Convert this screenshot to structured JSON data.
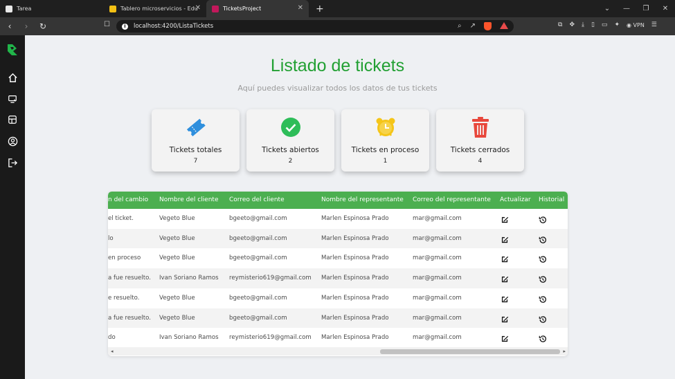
{
  "browser": {
    "tabs": [
      {
        "label": "Tarea",
        "favicon_color": "#e9e9e9"
      },
      {
        "label": "Tablero microservicios - Eduardo So",
        "favicon_color": "#f2c014"
      },
      {
        "label": "TicketsProject",
        "favicon_color": "#c2185b"
      }
    ],
    "url": "localhost:4200/ListaTickets",
    "vpn_label": "VPN"
  },
  "sidebar": {
    "items": [
      {
        "icon": "home-icon"
      },
      {
        "icon": "tickets-icon"
      },
      {
        "icon": "grid-icon"
      },
      {
        "icon": "user-circle-icon"
      },
      {
        "icon": "logout-icon"
      }
    ],
    "accent": "#21b54a"
  },
  "page": {
    "title": "Listado de tickets",
    "subtitle": "Aquí puedes visualizar todos los datos de tus tickets",
    "title_color": "#22a033"
  },
  "cards": [
    {
      "label": "Tickets totales",
      "value": "7",
      "icon": "ticket-icon",
      "color": "#2f8fdd"
    },
    {
      "label": "Tickets abiertos",
      "value": "2",
      "icon": "check-circle-icon",
      "color": "#2ebd59"
    },
    {
      "label": "Tickets en proceso",
      "value": "1",
      "icon": "alarm-clock-icon",
      "color": "#f5c518"
    },
    {
      "label": "Tickets cerrados",
      "value": "4",
      "icon": "trash-icon",
      "color": "#e8473b"
    }
  ],
  "table": {
    "header_color": "#4caf50",
    "columns": [
      "n del cambio",
      "Nombre del cliente",
      "Correo del cliente",
      "Nombre del representante",
      "Correo del representante",
      "Actualizar",
      "Historial"
    ],
    "rows": [
      [
        "el ticket.",
        "Vegeto Blue",
        "bgeeto@gmail.com",
        "Marlen Espinosa Prado",
        "mar@gmail.com"
      ],
      [
        "lo",
        "Vegeto Blue",
        "bgeeto@gmail.com",
        "Marlen Espinosa Prado",
        "mar@gmail.com"
      ],
      [
        "en proceso",
        "Vegeto Blue",
        "bgeeto@gmail.com",
        "Marlen Espinosa Prado",
        "mar@gmail.com"
      ],
      [
        "a fue resuelto.",
        "Ivan Soriano Ramos",
        "reymisterio619@gmail.com",
        "Marlen Espinosa Prado",
        "mar@gmail.com"
      ],
      [
        "e resuelto.",
        "Vegeto Blue",
        "bgeeto@gmail.com",
        "Marlen Espinosa Prado",
        "mar@gmail.com"
      ],
      [
        "a fue resuelto.",
        "Vegeto Blue",
        "bgeeto@gmail.com",
        "Marlen Espinosa Prado",
        "mar@gmail.com"
      ],
      [
        "do",
        "Ivan Soriano Ramos",
        "reymisterio619@gmail.com",
        "Marlen Espinosa Prado",
        "mar@gmail.com"
      ]
    ]
  }
}
